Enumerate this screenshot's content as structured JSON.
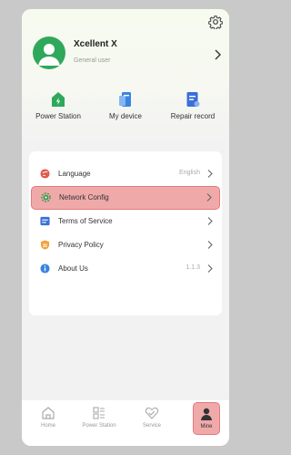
{
  "profile": {
    "name": "Xcellent X",
    "role": "General user"
  },
  "shortcuts": [
    {
      "label": "Power Station",
      "icon": "power-station-icon",
      "color": "#2fa85b"
    },
    {
      "label": "My device",
      "icon": "device-icon",
      "color": "#3a84e0"
    },
    {
      "label": "Repair record",
      "icon": "repair-record-icon",
      "color": "#3a6fd8"
    }
  ],
  "menu": [
    {
      "label": "Language",
      "value": "English",
      "icon": "language-icon",
      "color": "#e25a4a"
    },
    {
      "label": "Network Config",
      "value": "",
      "icon": "network-gear-icon",
      "color": "#3a9a52",
      "highlighted": true
    },
    {
      "label": "Terms of Service",
      "value": "",
      "icon": "terms-icon",
      "color": "#3a6fd8"
    },
    {
      "label": "Privacy Policy",
      "value": "",
      "icon": "privacy-icon",
      "color": "#f2a23a"
    },
    {
      "label": "About Us",
      "value": "1.1.3",
      "icon": "info-icon",
      "color": "#3a84e0"
    }
  ],
  "tabs": [
    {
      "label": "Home",
      "icon": "home-icon"
    },
    {
      "label": "Power Station",
      "icon": "grid-icon"
    },
    {
      "label": "Service",
      "icon": "service-icon"
    },
    {
      "label": "Mine",
      "icon": "person-icon",
      "active": true
    }
  ],
  "colors": {
    "accent": "#2fa85b",
    "highlight": "#f0a9a9"
  }
}
